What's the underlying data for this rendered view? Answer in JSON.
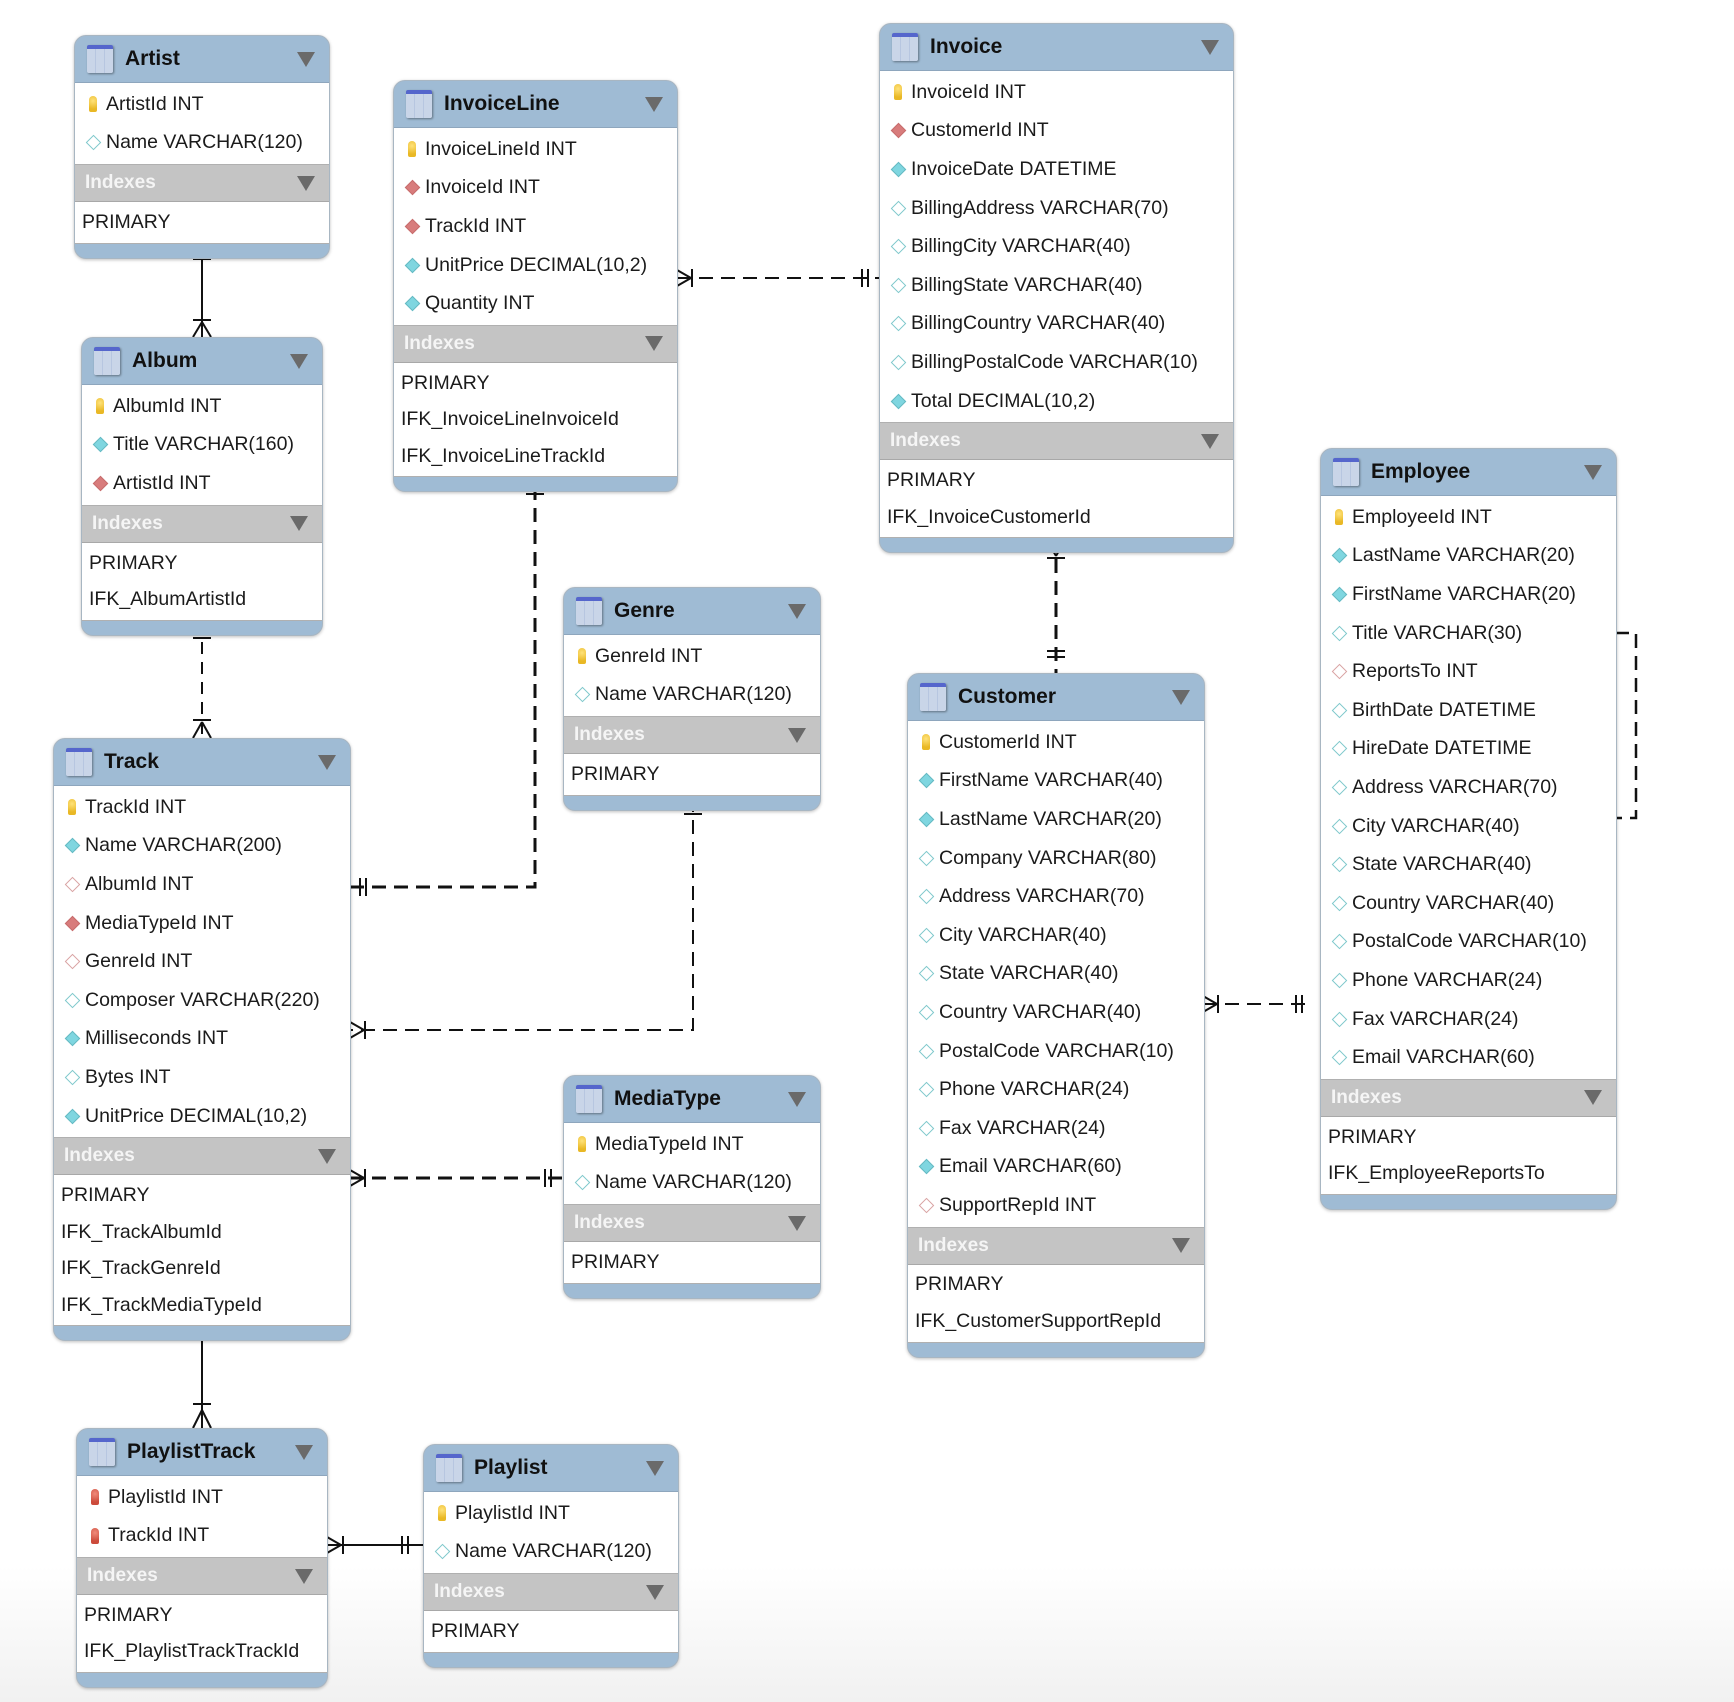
{
  "diagram": {
    "indexes_label": "Indexes",
    "tables": {
      "artist": {
        "name": "Artist",
        "columns": [
          {
            "text": "ArtistId INT",
            "icon": "primary-key"
          },
          {
            "text": "Name VARCHAR(120)",
            "icon": "nullable-column"
          }
        ],
        "indexes": [
          "PRIMARY"
        ]
      },
      "album": {
        "name": "Album",
        "columns": [
          {
            "text": "AlbumId INT",
            "icon": "primary-key"
          },
          {
            "text": "Title VARCHAR(160)",
            "icon": "not-null-column"
          },
          {
            "text": "ArtistId INT",
            "icon": "foreign-key-not-null"
          }
        ],
        "indexes": [
          "PRIMARY",
          "IFK_AlbumArtistId"
        ]
      },
      "invoiceline": {
        "name": "InvoiceLine",
        "columns": [
          {
            "text": "InvoiceLineId INT",
            "icon": "primary-key"
          },
          {
            "text": "InvoiceId INT",
            "icon": "foreign-key-not-null"
          },
          {
            "text": "TrackId INT",
            "icon": "foreign-key-not-null"
          },
          {
            "text": "UnitPrice DECIMAL(10,2)",
            "icon": "not-null-column"
          },
          {
            "text": "Quantity INT",
            "icon": "not-null-column"
          }
        ],
        "indexes": [
          "PRIMARY",
          "IFK_InvoiceLineInvoiceId",
          "IFK_InvoiceLineTrackId"
        ]
      },
      "invoice": {
        "name": "Invoice",
        "columns": [
          {
            "text": "InvoiceId INT",
            "icon": "primary-key"
          },
          {
            "text": "CustomerId INT",
            "icon": "foreign-key-not-null"
          },
          {
            "text": "InvoiceDate DATETIME",
            "icon": "not-null-column"
          },
          {
            "text": "BillingAddress VARCHAR(70)",
            "icon": "nullable-column"
          },
          {
            "text": "BillingCity VARCHAR(40)",
            "icon": "nullable-column"
          },
          {
            "text": "BillingState VARCHAR(40)",
            "icon": "nullable-column"
          },
          {
            "text": "BillingCountry VARCHAR(40)",
            "icon": "nullable-column"
          },
          {
            "text": "BillingPostalCode VARCHAR(10)",
            "icon": "nullable-column"
          },
          {
            "text": "Total DECIMAL(10,2)",
            "icon": "not-null-column"
          }
        ],
        "indexes": [
          "PRIMARY",
          "IFK_InvoiceCustomerId"
        ]
      },
      "genre": {
        "name": "Genre",
        "columns": [
          {
            "text": "GenreId INT",
            "icon": "primary-key"
          },
          {
            "text": "Name VARCHAR(120)",
            "icon": "nullable-column"
          }
        ],
        "indexes": [
          "PRIMARY"
        ]
      },
      "track": {
        "name": "Track",
        "columns": [
          {
            "text": "TrackId INT",
            "icon": "primary-key"
          },
          {
            "text": "Name VARCHAR(200)",
            "icon": "not-null-column"
          },
          {
            "text": "AlbumId INT",
            "icon": "foreign-key-nullable"
          },
          {
            "text": "MediaTypeId INT",
            "icon": "foreign-key-not-null"
          },
          {
            "text": "GenreId INT",
            "icon": "foreign-key-nullable"
          },
          {
            "text": "Composer VARCHAR(220)",
            "icon": "nullable-column"
          },
          {
            "text": "Milliseconds INT",
            "icon": "not-null-column"
          },
          {
            "text": "Bytes INT",
            "icon": "nullable-column"
          },
          {
            "text": "UnitPrice DECIMAL(10,2)",
            "icon": "not-null-column"
          }
        ],
        "indexes": [
          "PRIMARY",
          "IFK_TrackAlbumId",
          "IFK_TrackGenreId",
          "IFK_TrackMediaTypeId"
        ]
      },
      "mediatype": {
        "name": "MediaType",
        "columns": [
          {
            "text": "MediaTypeId INT",
            "icon": "primary-key"
          },
          {
            "text": "Name VARCHAR(120)",
            "icon": "nullable-column"
          }
        ],
        "indexes": [
          "PRIMARY"
        ]
      },
      "customer": {
        "name": "Customer",
        "columns": [
          {
            "text": "CustomerId INT",
            "icon": "primary-key"
          },
          {
            "text": "FirstName VARCHAR(40)",
            "icon": "not-null-column"
          },
          {
            "text": "LastName VARCHAR(20)",
            "icon": "not-null-column"
          },
          {
            "text": "Company VARCHAR(80)",
            "icon": "nullable-column"
          },
          {
            "text": "Address VARCHAR(70)",
            "icon": "nullable-column"
          },
          {
            "text": "City VARCHAR(40)",
            "icon": "nullable-column"
          },
          {
            "text": "State VARCHAR(40)",
            "icon": "nullable-column"
          },
          {
            "text": "Country VARCHAR(40)",
            "icon": "nullable-column"
          },
          {
            "text": "PostalCode VARCHAR(10)",
            "icon": "nullable-column"
          },
          {
            "text": "Phone VARCHAR(24)",
            "icon": "nullable-column"
          },
          {
            "text": "Fax VARCHAR(24)",
            "icon": "nullable-column"
          },
          {
            "text": "Email VARCHAR(60)",
            "icon": "not-null-column"
          },
          {
            "text": "SupportRepId INT",
            "icon": "foreign-key-nullable"
          }
        ],
        "indexes": [
          "PRIMARY",
          "IFK_CustomerSupportRepId"
        ]
      },
      "employee": {
        "name": "Employee",
        "columns": [
          {
            "text": "EmployeeId INT",
            "icon": "primary-key"
          },
          {
            "text": "LastName VARCHAR(20)",
            "icon": "not-null-column"
          },
          {
            "text": "FirstName VARCHAR(20)",
            "icon": "not-null-column"
          },
          {
            "text": "Title VARCHAR(30)",
            "icon": "nullable-column"
          },
          {
            "text": "ReportsTo INT",
            "icon": "foreign-key-nullable"
          },
          {
            "text": "BirthDate DATETIME",
            "icon": "nullable-column"
          },
          {
            "text": "HireDate DATETIME",
            "icon": "nullable-column"
          },
          {
            "text": "Address VARCHAR(70)",
            "icon": "nullable-column"
          },
          {
            "text": "City VARCHAR(40)",
            "icon": "nullable-column"
          },
          {
            "text": "State VARCHAR(40)",
            "icon": "nullable-column"
          },
          {
            "text": "Country VARCHAR(40)",
            "icon": "nullable-column"
          },
          {
            "text": "PostalCode VARCHAR(10)",
            "icon": "nullable-column"
          },
          {
            "text": "Phone VARCHAR(24)",
            "icon": "nullable-column"
          },
          {
            "text": "Fax VARCHAR(24)",
            "icon": "nullable-column"
          },
          {
            "text": "Email VARCHAR(60)",
            "icon": "nullable-column"
          }
        ],
        "indexes": [
          "PRIMARY",
          "IFK_EmployeeReportsTo"
        ]
      },
      "playlisttrack": {
        "name": "PlaylistTrack",
        "columns": [
          {
            "text": "PlaylistId INT",
            "icon": "primary-foreign-key"
          },
          {
            "text": "TrackId INT",
            "icon": "primary-foreign-key"
          }
        ],
        "indexes": [
          "PRIMARY",
          "IFK_PlaylistTrackTrackId"
        ]
      },
      "playlist": {
        "name": "Playlist",
        "columns": [
          {
            "text": "PlaylistId INT",
            "icon": "primary-key"
          },
          {
            "text": "Name VARCHAR(120)",
            "icon": "nullable-column"
          }
        ],
        "indexes": [
          "PRIMARY"
        ]
      }
    },
    "relationships": [
      {
        "from": "Artist",
        "to": "Album",
        "type": "one-to-many",
        "identifying": true
      },
      {
        "from": "Album",
        "to": "Track",
        "type": "one-to-many",
        "identifying": false
      },
      {
        "from": "Track",
        "to": "InvoiceLine",
        "type": "one-to-many",
        "identifying": false
      },
      {
        "from": "Genre",
        "to": "Track",
        "type": "one-to-many",
        "identifying": false
      },
      {
        "from": "MediaType",
        "to": "Track",
        "type": "one-to-many",
        "identifying": false
      },
      {
        "from": "Invoice",
        "to": "InvoiceLine",
        "type": "one-to-many",
        "identifying": false
      },
      {
        "from": "Customer",
        "to": "Invoice",
        "type": "one-to-many",
        "identifying": false
      },
      {
        "from": "Employee",
        "to": "Customer",
        "type": "one-to-many",
        "identifying": false
      },
      {
        "from": "Employee",
        "to": "Employee",
        "type": "one-to-many",
        "identifying": false
      },
      {
        "from": "Track",
        "to": "PlaylistTrack",
        "type": "one-to-many",
        "identifying": true
      },
      {
        "from": "Playlist",
        "to": "PlaylistTrack",
        "type": "one-to-many",
        "identifying": true
      }
    ],
    "colors": {
      "header": "#9fbbd4",
      "index_header": "#c4c4c4",
      "primary_key": "#e9b825",
      "foreign_key": "#d87c7c",
      "column": "#7fd6e0"
    }
  }
}
